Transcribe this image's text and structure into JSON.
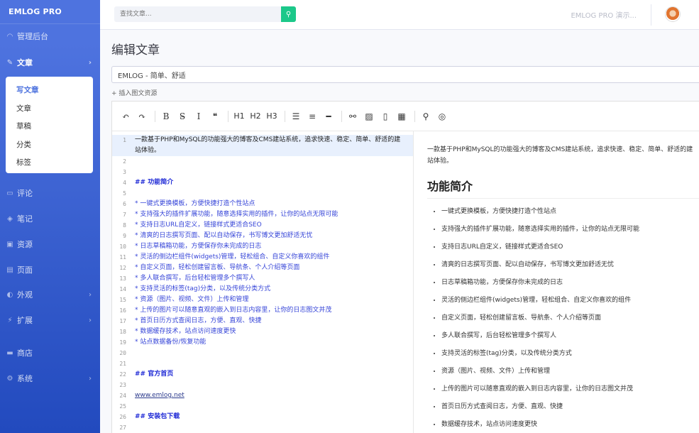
{
  "brand": "EMLOG PRO",
  "sidebar": {
    "items": [
      {
        "icon": "speedometer-icon",
        "glyph": "◠",
        "label": "管理后台",
        "chevron": false
      },
      {
        "icon": "pen-icon",
        "glyph": "✎",
        "label": "文章",
        "chevron": true,
        "active": true
      },
      {
        "icon": "comment-icon",
        "glyph": "▭",
        "label": "评论",
        "chevron": false
      },
      {
        "icon": "note-icon",
        "glyph": "◈",
        "label": "笔记",
        "chevron": false
      },
      {
        "icon": "image-icon",
        "glyph": "▣",
        "label": "资源",
        "chevron": false
      },
      {
        "icon": "page-icon",
        "glyph": "▤",
        "label": "页面",
        "chevron": false
      },
      {
        "icon": "palette-icon",
        "glyph": "◐",
        "label": "外观",
        "chevron": true
      },
      {
        "icon": "plug-icon",
        "glyph": "⚡",
        "label": "扩展",
        "chevron": true
      },
      {
        "icon": "store-icon",
        "glyph": "▬",
        "label": "商店",
        "chevron": false
      },
      {
        "icon": "gear-icon",
        "glyph": "⚙",
        "label": "系统",
        "chevron": true
      }
    ],
    "submenu": [
      "写文章",
      "文章",
      "草稿",
      "分类",
      "标签"
    ]
  },
  "topbar": {
    "search_placeholder": "查找文章...",
    "site_link": "EMLOG PRO 演示..."
  },
  "main": {
    "page_title": "编辑文章",
    "article_title": "EMLOG - 简单、舒适",
    "insert_media": "+ 插入图文资源"
  },
  "toolbar": [
    {
      "name": "undo-icon",
      "glyph": "↶"
    },
    {
      "name": "redo-icon",
      "glyph": "↷"
    },
    {
      "sep": true
    },
    {
      "name": "bold-icon",
      "glyph": "B"
    },
    {
      "name": "strikethrough-icon",
      "glyph": "S̶"
    },
    {
      "name": "italic-icon",
      "glyph": "I"
    },
    {
      "name": "quote-icon",
      "glyph": "❝"
    },
    {
      "sep": true
    },
    {
      "name": "h1-button",
      "glyph": "H1",
      "sans": true
    },
    {
      "name": "h2-button",
      "glyph": "H2",
      "sans": true
    },
    {
      "name": "h3-button",
      "glyph": "H3",
      "sans": true
    },
    {
      "sep": true
    },
    {
      "name": "unordered-list-icon",
      "glyph": "☰"
    },
    {
      "name": "ordered-list-icon",
      "glyph": "≡"
    },
    {
      "name": "horizontal-rule-icon",
      "glyph": "━"
    },
    {
      "sep": true
    },
    {
      "name": "link-icon",
      "glyph": "⚯"
    },
    {
      "name": "image-icon",
      "glyph": "▨"
    },
    {
      "name": "file-icon",
      "glyph": "▯"
    },
    {
      "name": "table-icon",
      "glyph": "▦"
    },
    {
      "sep": true
    },
    {
      "name": "search-icon",
      "glyph": "⚲"
    },
    {
      "name": "preview-toggle-icon",
      "glyph": "◎"
    }
  ],
  "code_lines": [
    {
      "n": "1",
      "text": "一款基于PHP和MySQL的功能强大的博客及CMS建站系统，追求快速、稳定、简单、舒适的建站体验。",
      "kind": "normal"
    },
    {
      "n": "2",
      "text": "",
      "kind": "normal"
    },
    {
      "n": "3",
      "text": "",
      "kind": "normal"
    },
    {
      "n": "4",
      "text": "## 功能简介",
      "kind": "heading"
    },
    {
      "n": "5",
      "text": "",
      "kind": "normal"
    },
    {
      "n": "6",
      "text": "* 一键式更换模板，方便快捷打造个性站点",
      "kind": "list"
    },
    {
      "n": "7",
      "text": "* 支持强大的插件扩展功能，随意选择实用的插件，让你的站点无限可能",
      "kind": "list"
    },
    {
      "n": "8",
      "text": "* 支持日志URL自定义，链接样式更适合SEO",
      "kind": "list"
    },
    {
      "n": "9",
      "text": "* 清爽的日志撰写页面、配以自动保存，书写博文更加舒适无忧",
      "kind": "list"
    },
    {
      "n": "10",
      "text": "* 日志草稿箱功能，方便保存你未完成的日志",
      "kind": "list"
    },
    {
      "n": "11",
      "text": "* 灵活的侧边栏组件(widgets)管理，轻松组合、自定义你喜欢的组件",
      "kind": "list"
    },
    {
      "n": "12",
      "text": "* 自定义页面，轻松创建留言板、导航条、个人介绍等页面",
      "kind": "list"
    },
    {
      "n": "13",
      "text": "* 多人联合撰写，后台轻松管理多个撰写人",
      "kind": "list"
    },
    {
      "n": "14",
      "text": "* 支持灵活的标签(tag)分类，以及传统分类方式",
      "kind": "list"
    },
    {
      "n": "15",
      "text": "* 资源（图片、视频、文件）上传和管理",
      "kind": "list"
    },
    {
      "n": "16",
      "text": "* 上传的图片可以随意直观的嵌入到日志内容里，让你的日志图文并茂",
      "kind": "list"
    },
    {
      "n": "17",
      "text": "* 首页日历方式查阅日志，方便、直观、快捷",
      "kind": "list"
    },
    {
      "n": "18",
      "text": "* 数据缓存技术，站点访问速度更快",
      "kind": "list"
    },
    {
      "n": "19",
      "text": "* 站点数据备份/恢复功能",
      "kind": "list"
    },
    {
      "n": "20",
      "text": "",
      "kind": "normal"
    },
    {
      "n": "21",
      "text": "",
      "kind": "normal"
    },
    {
      "n": "22",
      "text": "## 官方首页",
      "kind": "heading"
    },
    {
      "n": "23",
      "text": "",
      "kind": "normal"
    },
    {
      "n": "24",
      "text": "www.emlog.net",
      "kind": "link"
    },
    {
      "n": "25",
      "text": "",
      "kind": "normal"
    },
    {
      "n": "26",
      "text": "## 安装包下载",
      "kind": "heading"
    },
    {
      "n": "27",
      "text": "",
      "kind": "normal"
    }
  ],
  "preview": {
    "intro": "一款基于PHP和MySQL的功能强大的博客及CMS建站系统，追求快速、稳定、简单、舒适的建站体验。",
    "heading": "功能简介",
    "items": [
      "一键式更换模板，方便快捷打造个性站点",
      "支持强大的插件扩展功能，随意选择实用的插件，让你的站点无限可能",
      "支持日志URL自定义，链接样式更适合SEO",
      "清爽的日志撰写页面、配以自动保存，书写博文更加舒适无忧",
      "日志草稿箱功能，方便保存你未完成的日志",
      "灵活的侧边栏组件(widgets)管理，轻松组合、自定义你喜欢的组件",
      "自定义页面，轻松创建留言板、导航条、个人介绍等页面",
      "多人联合撰写，后台轻松管理多个撰写人",
      "支持灵活的标签(tag)分类，以及传统分类方式",
      "资源（图片、视频、文件）上传和管理",
      "上传的图片可以随意直观的嵌入到日志内容里，让你的日志图文并茂",
      "首页日历方式查阅日志，方便、直观、快捷",
      "数据缓存技术，站点访问速度更快"
    ]
  }
}
